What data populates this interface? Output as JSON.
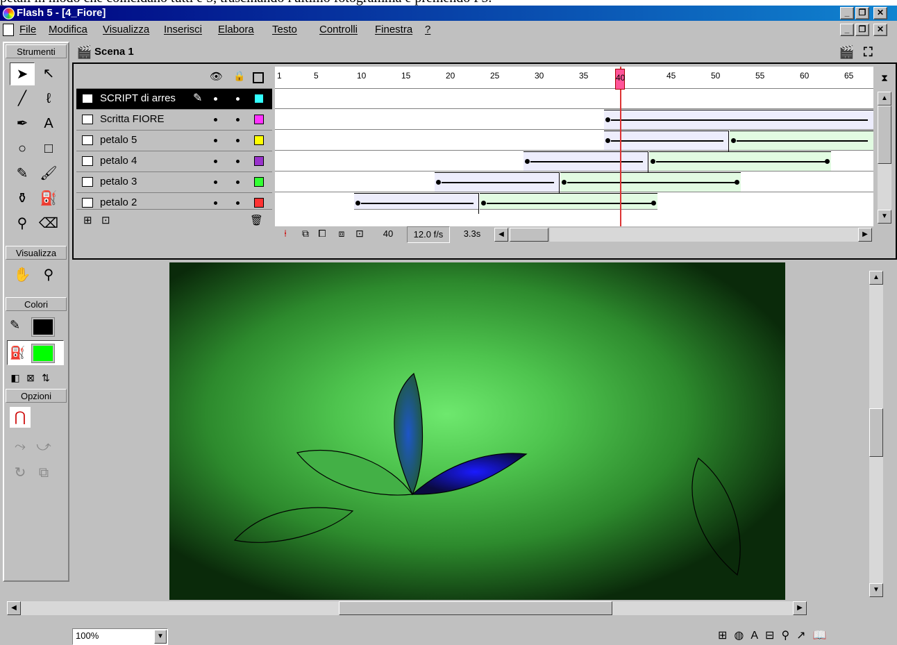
{
  "document": {
    "fragment_text": "petali in modo che coincidano tutti e 5, trascinando l'ultimo fotogramma e premendo F5."
  },
  "window": {
    "title": "Flash 5 - [4_Fiore]",
    "controls": [
      "_",
      "ð",
      "x"
    ]
  },
  "menubar": {
    "items": [
      "File",
      "Modifica",
      "Visualizza",
      "Inserisci",
      "Elabora",
      "Testo",
      "Controlli",
      "Finestra",
      "?"
    ]
  },
  "toolbox": {
    "section_tools": "Strumenti",
    "section_view": "Visualizza",
    "section_colors": "Colori",
    "section_options": "Opzioni",
    "stroke_color": "#000000",
    "fill_color": "#00ff00"
  },
  "scene": {
    "label": "Scena 1"
  },
  "timeline": {
    "frame_numbers": [
      "1",
      "5",
      "10",
      "15",
      "20",
      "25",
      "30",
      "35",
      "40",
      "45",
      "50",
      "55",
      "60",
      "65"
    ],
    "current_frame": "40",
    "frame_rate": "12.0 f/s",
    "elapsed": "3.3s",
    "layers": [
      {
        "name": "SCRIPT di arres",
        "color": "#33ffff",
        "active": true
      },
      {
        "name": "Scritta FIORE",
        "color": "#ff33ff",
        "active": false
      },
      {
        "name": "petalo 5",
        "color": "#ffff00",
        "active": false
      },
      {
        "name": "petalo 4",
        "color": "#9933cc",
        "active": false
      },
      {
        "name": "petalo 3",
        "color": "#33ff33",
        "active": false
      },
      {
        "name": "petalo 2",
        "color": "#ff3333",
        "active": false
      }
    ]
  },
  "statusbar": {
    "zoom": "100%"
  }
}
